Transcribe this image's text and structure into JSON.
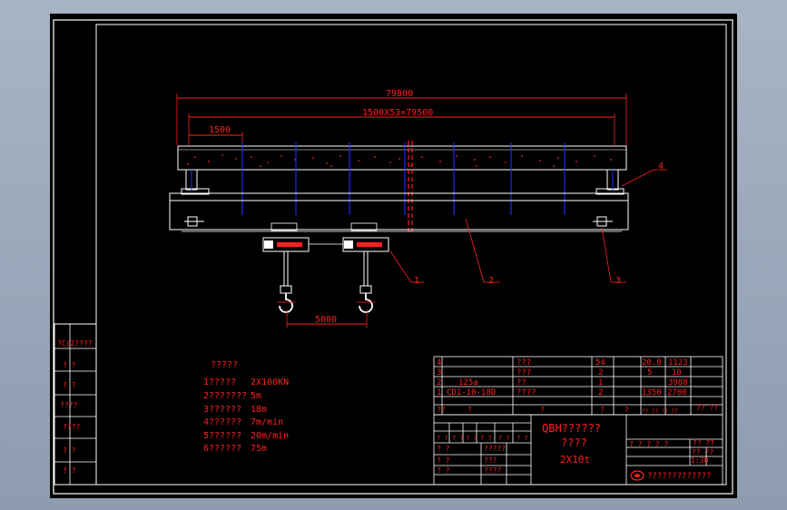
{
  "drawing": {
    "dims": {
      "overall": "79800",
      "span_pitch": "1500X53=79500",
      "bay": "1500",
      "hook_spacing": "5000"
    },
    "balloons": [
      "1",
      "2",
      "3",
      "4"
    ]
  },
  "left_strip": [
    "?C(2????",
    "? ?",
    "? ?",
    "????",
    "????",
    "? ?",
    "? ?"
  ],
  "specs": {
    "title": "?????",
    "rows": [
      {
        "label": "1?????",
        "value": "2X100KN"
      },
      {
        "label": "2???????",
        "value": "5m"
      },
      {
        "label": "3??????",
        "value": "18m"
      },
      {
        "label": "4??????",
        "value": "7m/min"
      },
      {
        "label": "5??????",
        "value": "20m/min"
      },
      {
        "label": "6??????",
        "value": "75m"
      }
    ]
  },
  "bom": {
    "rows": [
      {
        "no": "4",
        "code": "",
        "name": "???",
        "qty": "54",
        "w1": "20.8",
        "w2": "1123"
      },
      {
        "no": "3",
        "code": "",
        "name": "???",
        "qty": "2",
        "w1": "5",
        "w2": "10"
      },
      {
        "no": "2",
        "code": "125a",
        "name": "??",
        "qty": "1",
        "w1": "",
        "w2": "3988"
      },
      {
        "no": "1",
        "code": "CD1-10-18D",
        "name": "????",
        "qty": "2",
        "w1": "1350",
        "w2": "2700"
      }
    ],
    "header": [
      "??",
      "?",
      "?",
      "?",
      "?",
      "?",
      "? ?",
      "?",
      "? ?"
    ],
    "weight_label": "?? ??",
    "weight_sub": "?? ?? ?? ??"
  },
  "title_block": {
    "title": "QBH??????",
    "subtitle": "????",
    "spec": "2X10t",
    "stage": "? ? ? ? ?",
    "sheet_no": "?? ??",
    "scale": "?? ??",
    "scale_value": "1:30",
    "company": "?????????????",
    "rev_labels": [
      "? ?",
      "? ?",
      "? ?",
      "? ?",
      "? ?",
      "? ?"
    ],
    "sign_left": [
      "? ?",
      "? ?",
      "? ?"
    ],
    "sign_mid": [
      "?????",
      "???",
      "????"
    ]
  },
  "colors": {
    "border": "#ffffff",
    "red": "#ff2020",
    "blue": "#2030ff",
    "white": "#ffffff"
  }
}
